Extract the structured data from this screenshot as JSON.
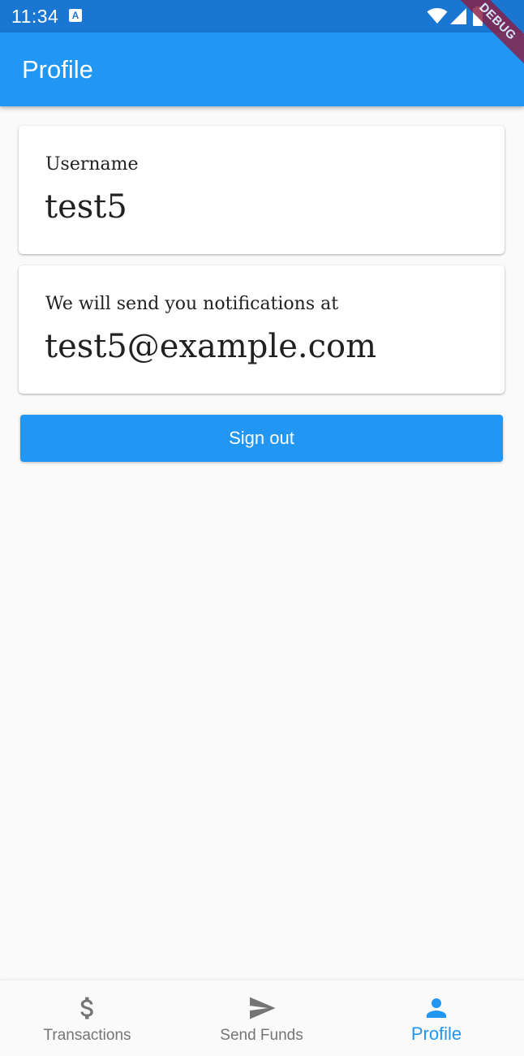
{
  "status_bar": {
    "time": "11:34",
    "notification_icon": "a-box-icon",
    "icons": [
      "wifi-icon",
      "signal-icon",
      "battery-icon"
    ]
  },
  "debug_banner": "DEBUG",
  "app_bar": {
    "title": "Profile",
    "color": "#2196f3"
  },
  "cards": {
    "username": {
      "label": "Username",
      "value": "test5"
    },
    "email": {
      "label": "We will send you notifications at",
      "value": "test5@example.com"
    }
  },
  "sign_out_label": "Sign out",
  "bottom_nav": {
    "items": [
      {
        "label": "Transactions",
        "icon": "dollar-icon",
        "active": false
      },
      {
        "label": "Send Funds",
        "icon": "send-icon",
        "active": false
      },
      {
        "label": "Profile",
        "icon": "person-icon",
        "active": true
      }
    ],
    "active_color": "#2196f3",
    "inactive_color": "#757575"
  }
}
